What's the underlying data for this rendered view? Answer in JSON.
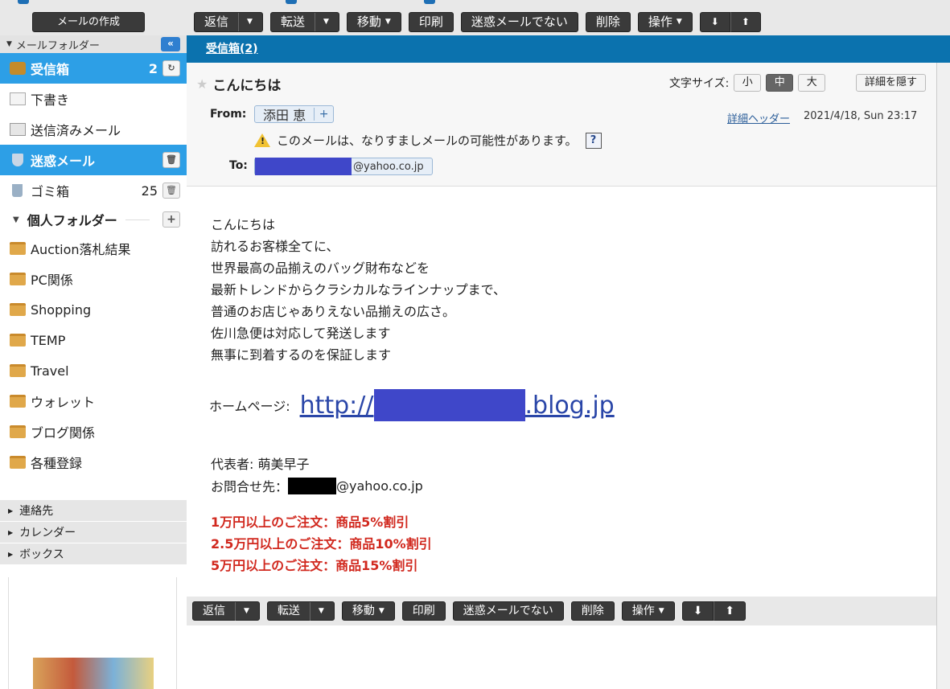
{
  "sidebar": {
    "compose_label": "メールの作成",
    "folder_header": "メールフォルダー",
    "folders": [
      {
        "label": "受信箱",
        "count": "2"
      },
      {
        "label": "下書き"
      },
      {
        "label": "送信済みメール"
      },
      {
        "label": "迷惑メール"
      },
      {
        "label": "ゴミ箱",
        "count": "25"
      }
    ],
    "personal_header": "個人フォルダー",
    "personal_folders": [
      "Auction落札結果",
      "PC関係",
      "Shopping",
      "TEMP",
      "Travel",
      "ウォレット",
      "ブログ関係",
      "各種登録"
    ],
    "sections": [
      "連絡先",
      "カレンダー",
      "ボックス"
    ]
  },
  "toolbar": {
    "reply": "返信",
    "forward": "転送",
    "move": "移動",
    "print": "印刷",
    "not_spam": "迷惑メールでない",
    "delete": "削除",
    "actions": "操作"
  },
  "tab": {
    "label": "受信箱(2)"
  },
  "message": {
    "subject": "こんにちは",
    "font_size_label": "文字サイズ:",
    "font_sizes": [
      "小",
      "中",
      "大"
    ],
    "hide_details": "詳細を隠す",
    "from_label": "From:",
    "from_name": "添田 恵",
    "detail_header": "詳細ヘッダー",
    "date": "2021/4/18, Sun 23:17",
    "warning": "このメールは、なりすましメールの可能性があります。",
    "to_label": "To:",
    "to_domain": "@yahoo.co.jp"
  },
  "body": {
    "lines": [
      "こんにちは",
      "訪れるお客様全てに、",
      "世界最高の品揃えのバッグ財布などを",
      "最新トレンドからクラシカルなラインナップまで、",
      "普通のお店じゃありえない品揃えの広さ。",
      "佐川急便は対応して発送します",
      "無事に到着するのを保証します"
    ],
    "homepage_label": "ホームページ:",
    "link_prefix": "http://",
    "link_suffix": ".blog.jp",
    "representative": "代表者: 萌美早子",
    "contact_label": "お問合せ先：",
    "contact_domain": "@yahoo.co.jp",
    "discounts": [
      "1万円以上のご注文：商品5%割引",
      "2.5万円以上のご注文：商品10%割引",
      "5万円以上のご注文：商品15%割引"
    ]
  },
  "colors": {
    "accent": "#2d9fe6",
    "tab_bar": "#0b72ae",
    "discount": "#d1281e",
    "toolbar_button": "#3a3a3a"
  }
}
